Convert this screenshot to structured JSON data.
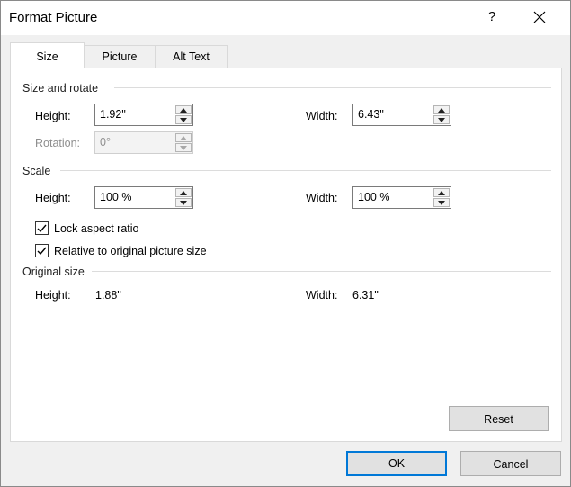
{
  "window": {
    "title": "Format Picture",
    "help_label": "?"
  },
  "tabs": [
    {
      "label": "Size"
    },
    {
      "label": "Picture"
    },
    {
      "label": "Alt Text"
    }
  ],
  "size_and_rotate": {
    "title": "Size and rotate",
    "height_label": "Height:",
    "height_value": "1.92\"",
    "width_label": "Width:",
    "width_value": "6.43\"",
    "rotation_label": "Rotation:",
    "rotation_value": "0°"
  },
  "scale": {
    "title": "Scale",
    "height_label": "Height:",
    "height_value": "100 %",
    "width_label": "Width:",
    "width_value": "100 %",
    "lock_aspect_label": "Lock aspect ratio",
    "lock_aspect_checked": true,
    "relative_label": "Relative to original picture size",
    "relative_checked": true
  },
  "original_size": {
    "title": "Original size",
    "height_label": "Height:",
    "height_value": "1.88\"",
    "width_label": "Width:",
    "width_value": "6.31\""
  },
  "buttons": {
    "reset": "Reset",
    "ok": "OK",
    "cancel": "Cancel"
  }
}
